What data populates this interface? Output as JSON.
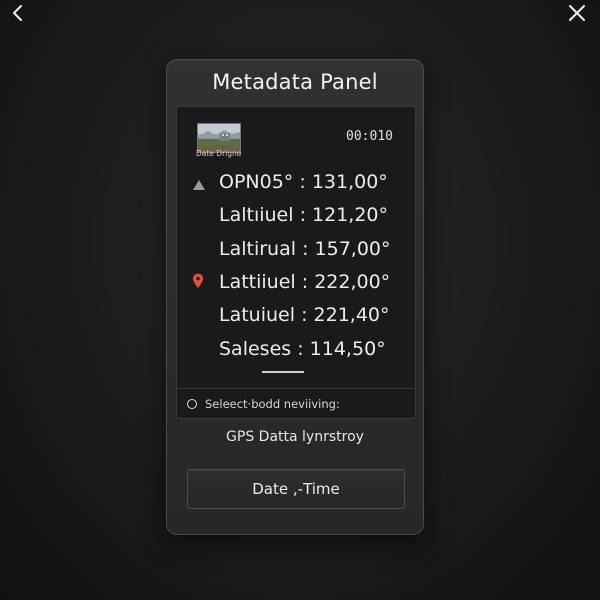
{
  "window": {
    "back_icon": "chevron-left-icon",
    "close_icon": "close-icon"
  },
  "panel": {
    "title": "Metadata Panel",
    "thumbnail_label": "Date Drigne",
    "time": "00:010",
    "rows": [
      {
        "label": "OPN05°",
        "separator": ":",
        "value": "131,00°",
        "icon": "triangle-up-icon"
      },
      {
        "label": "Laltıiuel",
        "separator": ":",
        "value": "121,20°",
        "icon": ""
      },
      {
        "label": "Laltirual",
        "separator": ":",
        "value": "157,00°",
        "icon": ""
      },
      {
        "label": "Lattiiuel",
        "separator": ":",
        "value": "222,00°",
        "icon": "location-pin-icon"
      },
      {
        "label": "Latuiuel",
        "separator": ":",
        "value": "221,40°",
        "icon": ""
      },
      {
        "label": "Saleses",
        "separator": ":",
        "value": "114,50°",
        "icon": ""
      }
    ],
    "radio_label": "Seleect·bodd neviiving:",
    "caption": "GPS Datta lynrstroy",
    "button_label": "Date ,‑Time"
  },
  "colors": {
    "background": "#1b1b1b",
    "panel": "#2d2d2d",
    "inner": "#1a1a1a",
    "pin": "#e8503a"
  }
}
